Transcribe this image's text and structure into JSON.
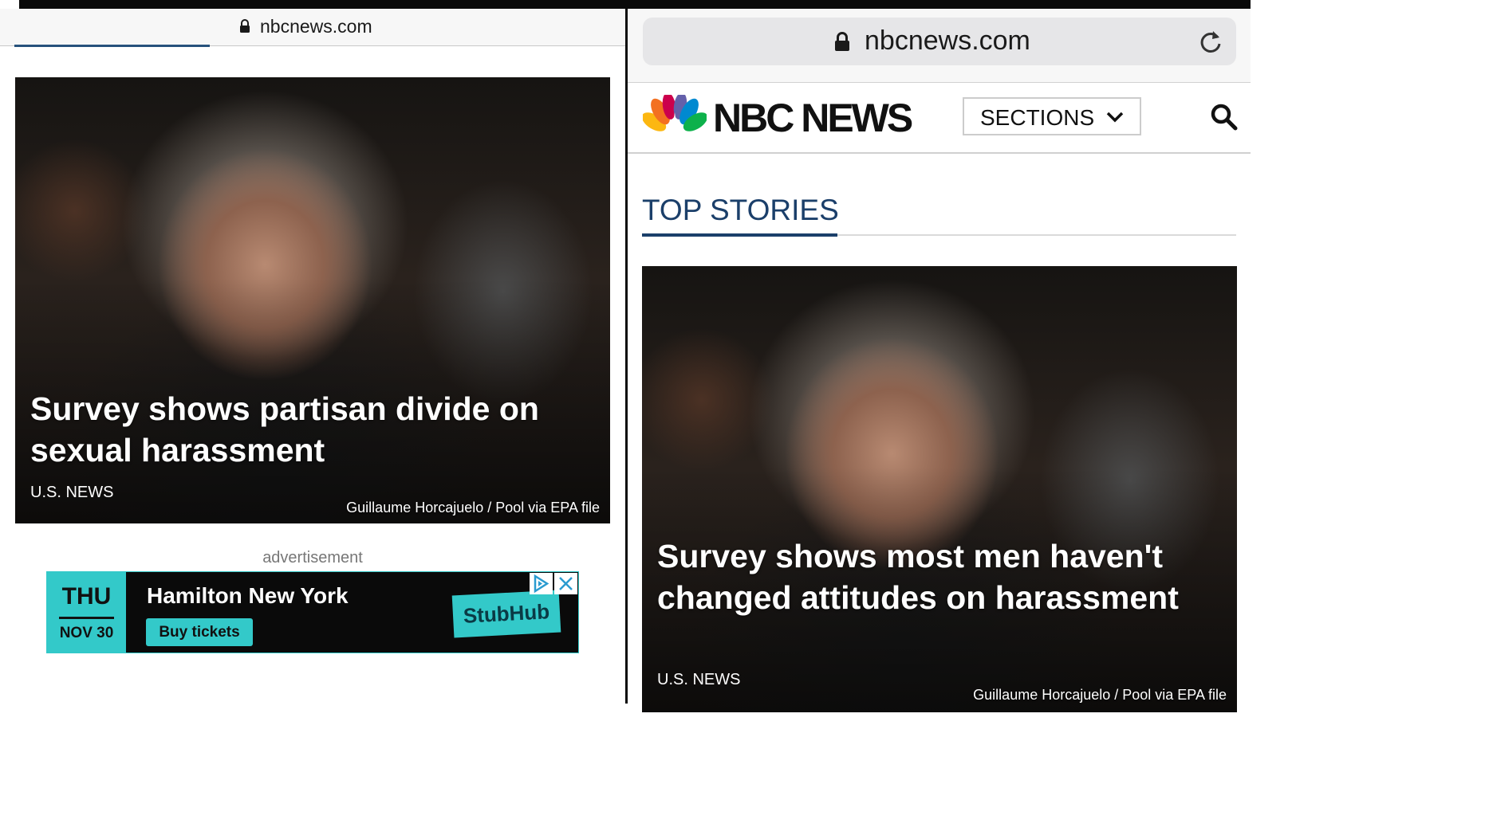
{
  "left_panel": {
    "url": "nbcnews.com",
    "story": {
      "headline": "Survey shows partisan divide on sexual harassment",
      "section": "U.S. NEWS",
      "credit": "Guillaume Horcajuelo / Pool via EPA file"
    },
    "advertisement": {
      "label": "advertisement",
      "day": "THU",
      "date": "NOV 30",
      "title": "Hamilton New York",
      "cta": "Buy tickets",
      "brand": "StubHub"
    }
  },
  "right_panel": {
    "url": "nbcnews.com",
    "logo_text": "NBC NEWS",
    "sections_label": "SECTIONS",
    "top_stories_title": "TOP STORIES",
    "story": {
      "headline": "Survey shows most men haven't changed attitudes on harassment",
      "section": "U.S. NEWS",
      "credit": "Guillaume Horcajuelo / Pool via EPA file"
    }
  },
  "icons": [
    "lock-icon",
    "reload-icon",
    "nbc-peacock-icon",
    "chevron-down-icon",
    "search-icon",
    "adchoices-icon",
    "close-icon"
  ],
  "colors": {
    "accent_navy": "#1b3f6a",
    "ad_teal": "#33c9c9",
    "progress_blue": "#27527c"
  }
}
